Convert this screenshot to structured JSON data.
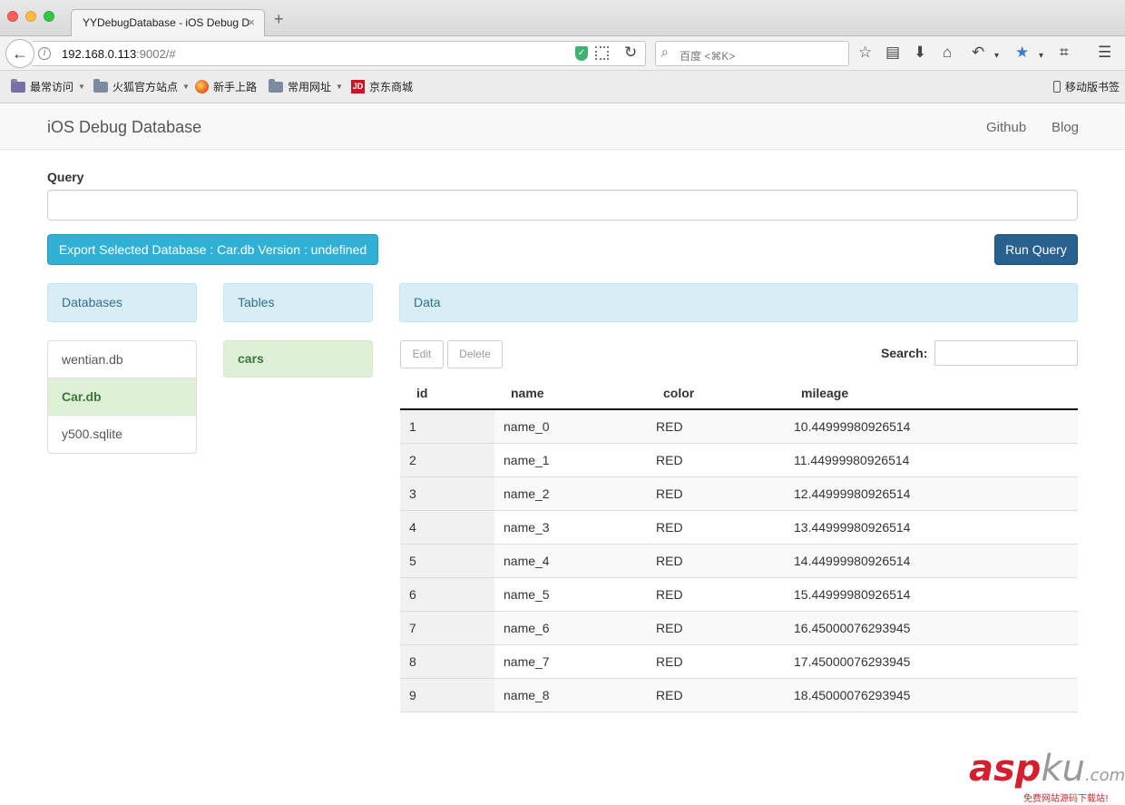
{
  "browser": {
    "tab_title": "YYDebugDatabase - iOS Debug D",
    "tab_close": "×",
    "new_tab": "+",
    "url_host": "192.168.0.113",
    "url_rest": ":9002/#",
    "search_placeholder": "百度 <⌘K>",
    "bookmarks": [
      "最常访问",
      "火狐官方站点",
      "新手上路",
      "常用网址",
      "京东商城"
    ],
    "mobile_bookmarks": "移动版书签",
    "jd_badge": "JD"
  },
  "app": {
    "brand": "iOS Debug Database",
    "nav_links": [
      "Github",
      "Blog"
    ],
    "query_label": "Query",
    "export_button": "Export Selected Database : Car.db Version : undefined",
    "run_button": "Run Query",
    "panels": {
      "databases": "Databases",
      "tables": "Tables",
      "data": "Data"
    },
    "databases": [
      {
        "name": "wentian.db",
        "active": false
      },
      {
        "name": "Car.db",
        "active": true
      },
      {
        "name": "y500.sqlite",
        "active": false
      }
    ],
    "tables": [
      "cars"
    ],
    "edit_button": "Edit",
    "delete_button": "Delete",
    "search_label": "Search:",
    "columns": [
      "id",
      "name",
      "color",
      "mileage"
    ],
    "rows": [
      [
        "1",
        "name_0",
        "RED",
        "10.44999980926514"
      ],
      [
        "2",
        "name_1",
        "RED",
        "11.44999980926514"
      ],
      [
        "3",
        "name_2",
        "RED",
        "12.44999980926514"
      ],
      [
        "4",
        "name_3",
        "RED",
        "13.44999980926514"
      ],
      [
        "5",
        "name_4",
        "RED",
        "14.44999980926514"
      ],
      [
        "6",
        "name_5",
        "RED",
        "15.44999980926514"
      ],
      [
        "7",
        "name_6",
        "RED",
        "16.45000076293945"
      ],
      [
        "8",
        "name_7",
        "RED",
        "17.45000076293945"
      ],
      [
        "9",
        "name_8",
        "RED",
        "18.45000076293945"
      ]
    ]
  },
  "watermark": {
    "brand_a": "asp",
    "brand_b": "ku",
    "brand_c": ".com",
    "sub": "免费网站源码下载站!"
  }
}
